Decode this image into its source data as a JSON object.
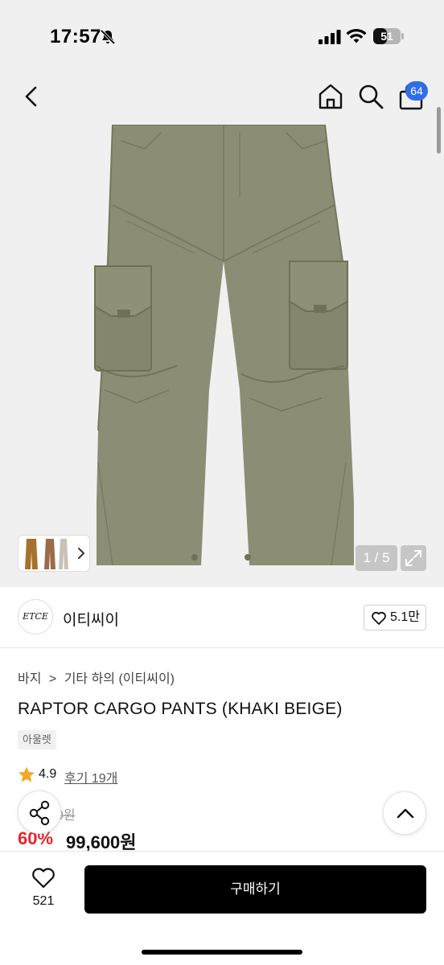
{
  "status_bar": {
    "time": "17:57",
    "battery": "51",
    "battery_level": 0.51,
    "icons": [
      "bell-off-icon",
      "signal-icon",
      "wifi-icon",
      "battery-icon"
    ]
  },
  "nav": {
    "back_icon": "chevron-left-icon",
    "home_icon": "home-icon",
    "search_icon": "search-icon",
    "bag_icon": "shopping-bag-icon",
    "cart_count": "64",
    "badge_color": "#2f6ee8"
  },
  "gallery": {
    "page_counter": "1 / 5",
    "expand_icon": "expand-icon",
    "thumb_chevron_icon": "chevron-right-icon",
    "product_color": "#8b8e74"
  },
  "brand": {
    "logo_text": "ETCE",
    "name": "이티씨이",
    "like_count": "5.1만"
  },
  "product": {
    "breadcrumb": [
      "바지",
      "기타 하의 (이티씨이)"
    ],
    "breadcrumb_separator": ">",
    "title": "RAPTOR CARGO PANTS (KHAKI BEIGE)",
    "tag": "아울렛",
    "rating": "4.9",
    "reviews": "후기 19개",
    "original_price": "0원",
    "discount": "60%",
    "sale_price": "99,600원",
    "discount_color": "#e8232a"
  },
  "bottom_bar": {
    "wish_count": "521",
    "buy_label": "구매하기",
    "share_icon": "share-icon",
    "scroll_up_icon": "chevron-up-icon"
  }
}
